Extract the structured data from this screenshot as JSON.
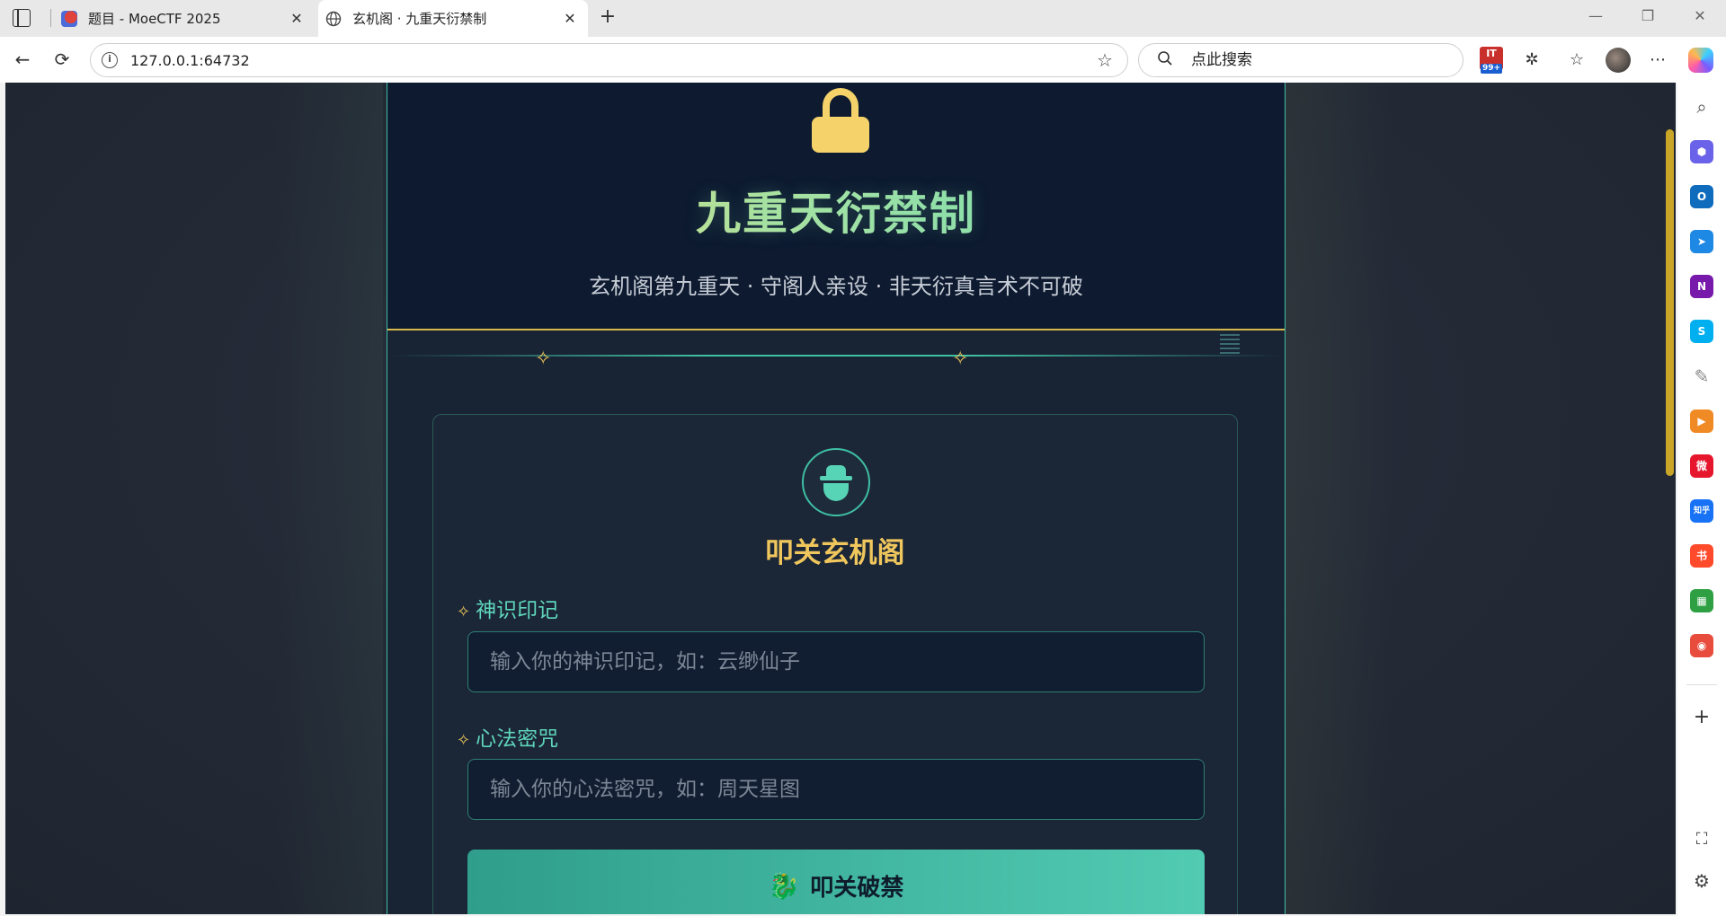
{
  "browser": {
    "tabs": [
      {
        "title": "题目 - MoeCTF 2025",
        "active": false
      },
      {
        "title": "玄机阁 · 九重天衍禁制",
        "active": true
      }
    ],
    "close_glyph": "✕",
    "new_tab_glyph": "+",
    "url": "127.0.0.1:64732",
    "search_placeholder": "点此搜索",
    "ext_badge_label": "IT",
    "ext_badge_count": "99+",
    "icons": {
      "back": "←",
      "reload": "⟳",
      "star": "☆",
      "search": "🔍",
      "puzzle": "✲",
      "favorites": "☆",
      "more": "⋯",
      "minimize": "—",
      "restore": "❐",
      "close": "✕"
    }
  },
  "sidebar": {
    "items": [
      {
        "name": "search",
        "glyph": "⌕",
        "color": "#555555"
      },
      {
        "name": "copilot-hex",
        "glyph": "⬢",
        "color": "#6a62e8"
      },
      {
        "name": "outlook",
        "glyph": "O",
        "color": "#0f6cbd"
      },
      {
        "name": "send",
        "glyph": "➤",
        "color": "#1e88e5"
      },
      {
        "name": "onenote",
        "glyph": "N",
        "color": "#7719aa"
      },
      {
        "name": "skype",
        "glyph": "S",
        "color": "#00aff0"
      },
      {
        "name": "bird",
        "glyph": "✎",
        "color": "#888888"
      },
      {
        "name": "video",
        "glyph": "▶",
        "color": "#f08a24"
      },
      {
        "name": "weibo",
        "glyph": "微",
        "color": "#e6162d"
      },
      {
        "name": "zhihu",
        "glyph": "知乎",
        "color": "#1772f6"
      },
      {
        "name": "xiaohongshu",
        "glyph": "书",
        "color": "#ff4a2b"
      },
      {
        "name": "grid-app",
        "glyph": "▦",
        "color": "#2ea043"
      },
      {
        "name": "chat-app",
        "glyph": "◉",
        "color": "#e84c3d"
      }
    ],
    "add_glyph": "+",
    "screenshot_glyph": "⛶",
    "settings_glyph": "⚙"
  },
  "page": {
    "header_title": "九重天衍禁制",
    "header_subtitle": "玄机阁第九重天 · 守阁人亲设 · 非天衍真言术不可破",
    "sparkle": "✧",
    "card_title": "叩关玄机阁",
    "fields": [
      {
        "label": "神识印记",
        "placeholder": "输入你的神识印记，如：云缈仙子"
      },
      {
        "label": "心法密咒",
        "placeholder": "输入你的心法密咒，如：周天星图"
      }
    ],
    "submit_label": "叩关破禁",
    "submit_glyph": "🐉"
  },
  "colors": {
    "accent_teal": "#3fbfa3",
    "accent_gold": "#f0c75c",
    "panel_bg": "#182333",
    "header_bg": "#0d1a30"
  }
}
